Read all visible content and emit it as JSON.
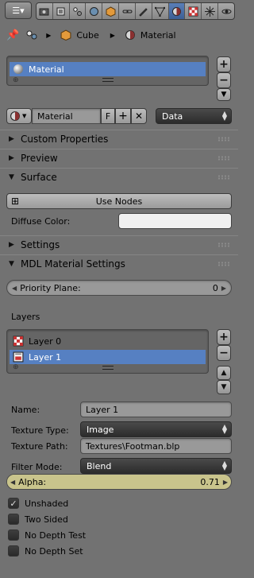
{
  "header": {
    "context_icons": [
      "editor-type-icon",
      "render-icon",
      "render-layers-icon",
      "scene-icon",
      "world-icon",
      "object-icon",
      "constraints-icon",
      "modifiers-icon",
      "data-icon",
      "material-icon",
      "texture-icon",
      "particles-icon",
      "physics-icon"
    ],
    "active_tab": "material-icon"
  },
  "breadcrumb": {
    "object": "Cube",
    "material": "Material"
  },
  "material_slots": {
    "items": [
      {
        "label": "Material"
      }
    ]
  },
  "material_datablock": {
    "name": "Material",
    "fake_user_label": "F",
    "link": "Data"
  },
  "panels": {
    "custom_properties": "Custom Properties",
    "preview": "Preview",
    "surface": "Surface",
    "settings": "Settings",
    "mdl": "MDL Material Settings"
  },
  "surface": {
    "use_nodes_label": "Use Nodes",
    "diffuse_label": "Diffuse Color:",
    "diffuse_color": "#f0f0f0"
  },
  "mdl": {
    "priority_label": "Priority Plane:",
    "priority_value": "0",
    "layers_label": "Layers",
    "layers": [
      {
        "label": "Layer 0"
      },
      {
        "label": "Layer 1"
      }
    ],
    "name_label": "Name:",
    "name_value": "Layer 1",
    "texture_type_label": "Texture Type:",
    "texture_type_value": "Image",
    "texture_path_label": "Texture Path:",
    "texture_path_value": "Textures\\Footman.blp",
    "filter_mode_label": "Filter Mode:",
    "filter_mode_value": "Blend",
    "alpha_label": "Alpha:",
    "alpha_value": "0.71",
    "alpha_fraction": 0.71,
    "alpha_color": "#c9c48c",
    "flags": [
      {
        "label": "Unshaded",
        "checked": true
      },
      {
        "label": "Two Sided",
        "checked": false
      },
      {
        "label": "No Depth Test",
        "checked": false
      },
      {
        "label": "No Depth Set",
        "checked": false
      }
    ]
  },
  "colors": {
    "selection": "#5680c2",
    "background": "#727272"
  }
}
